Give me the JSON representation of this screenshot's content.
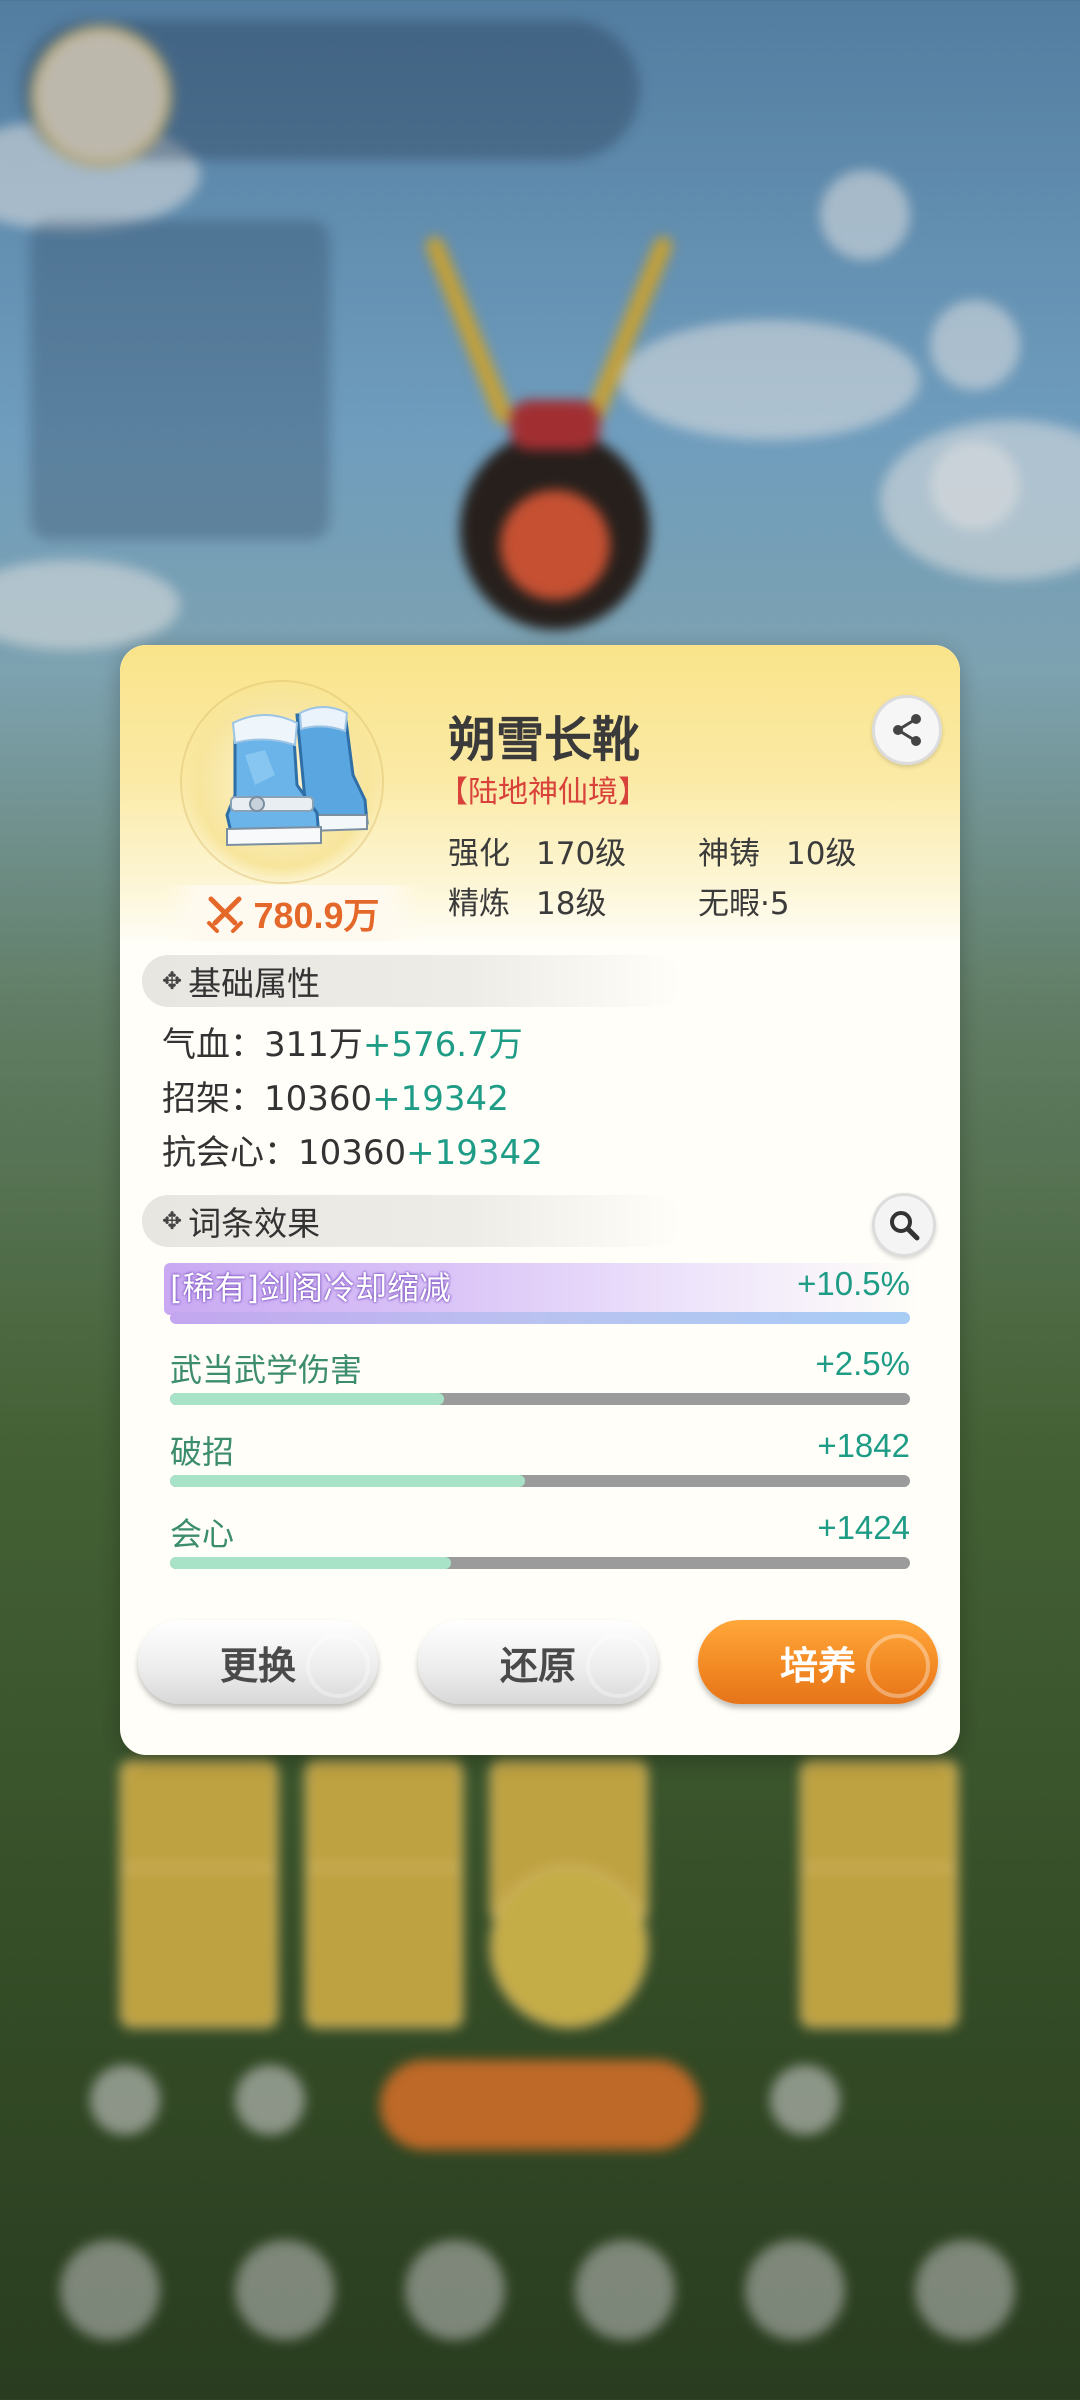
{
  "item": {
    "name": "朔雪长靴",
    "realm": "【陆地神仙境】",
    "power": "780.9万",
    "stats": [
      {
        "label": "强化",
        "value": "170级"
      },
      {
        "label": "神铸",
        "value": "10级"
      },
      {
        "label": "精炼",
        "value": "18级"
      },
      {
        "label": "无暇·5",
        "value": ""
      }
    ]
  },
  "base": {
    "title": "基础属性",
    "lines": [
      {
        "label": "气血：",
        "base": "311万",
        "bonus": "+576.7万"
      },
      {
        "label": "招架：",
        "base": "10360",
        "bonus": "+19342"
      },
      {
        "label": "抗会心：",
        "base": "10360",
        "bonus": "+19342"
      }
    ]
  },
  "affixes": {
    "title": "词条效果",
    "rare": {
      "name": "[稀有]剑阁冷却缩减",
      "value": "+10.5%",
      "level": 1.0
    },
    "items": [
      {
        "name": "武当武学伤害",
        "value": "+2.5%",
        "level": 0.37
      },
      {
        "name": "破招",
        "value": "+1842",
        "level": 0.48
      },
      {
        "name": "会心",
        "value": "+1424",
        "level": 0.38
      }
    ]
  },
  "buttons": {
    "replace": "更换",
    "restore": "还原",
    "train": "培养"
  },
  "colors": {
    "accent_orange": "#f28822",
    "bonus_green": "#1e9c86",
    "realm_red": "#d9423a"
  }
}
